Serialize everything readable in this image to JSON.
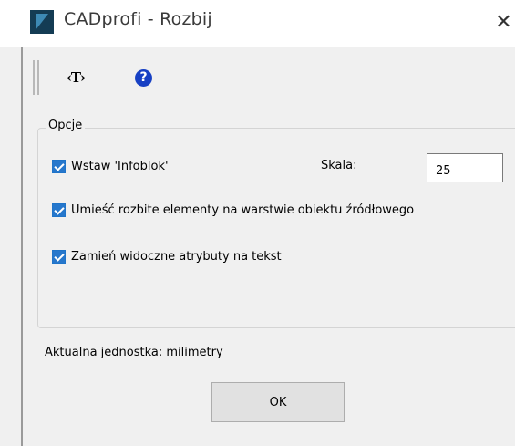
{
  "window": {
    "title": "CADprofi - Rozbij",
    "close_glyph": "✕"
  },
  "toolbar": {
    "text_tool_label": "‹T›",
    "help_glyph": "?"
  },
  "options": {
    "group_label": "Opcje",
    "insert_infoblock": {
      "label": "Wstaw 'Infoblok'",
      "checked": true
    },
    "scale_label": "Skala:",
    "scale_value": "25",
    "place_on_source_layer": {
      "label": "Umieść rozbite elementy na warstwie obiektu źródłowego",
      "checked": true
    },
    "convert_attributes": {
      "label": "Zamień widoczne atrybuty na tekst",
      "checked": true
    }
  },
  "status": {
    "units_text": "Aktualna jednostka: milimetry"
  },
  "buttons": {
    "ok_label": "OK"
  },
  "colors": {
    "accent": "#2677cc",
    "help_icon": "#1740c4"
  }
}
